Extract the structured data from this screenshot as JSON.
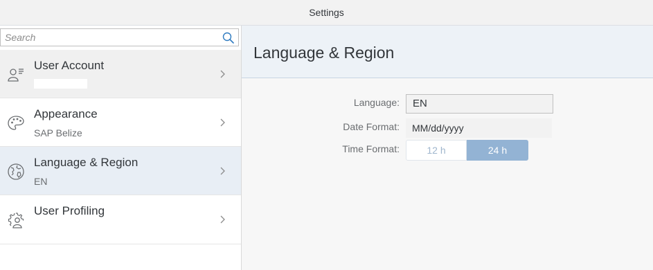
{
  "window": {
    "title": "Settings"
  },
  "search": {
    "placeholder": "Search"
  },
  "sidebar": {
    "items": [
      {
        "label": "User Account",
        "sublabel": "",
        "icon": "user-account-icon",
        "selected": false
      },
      {
        "label": "Appearance",
        "sublabel": "SAP Belize",
        "icon": "palette-icon",
        "selected": false
      },
      {
        "label": "Language & Region",
        "sublabel": "EN",
        "icon": "globe-icon",
        "selected": true
      },
      {
        "label": "User Profiling",
        "sublabel": "",
        "icon": "user-settings-icon",
        "selected": false
      }
    ]
  },
  "detail": {
    "title": "Language & Region",
    "language_label": "Language:",
    "language_value": "EN",
    "date_format_label": "Date Format:",
    "date_format_value": "MM/dd/yyyy",
    "time_format_label": "Time Format:",
    "time_format_options": [
      "12 h",
      "24 h"
    ],
    "time_format_selected": "24 h"
  },
  "colors": {
    "accent": "#93b3d4",
    "selected_row": "#e8eef5",
    "header_bg": "#edf2f7"
  }
}
